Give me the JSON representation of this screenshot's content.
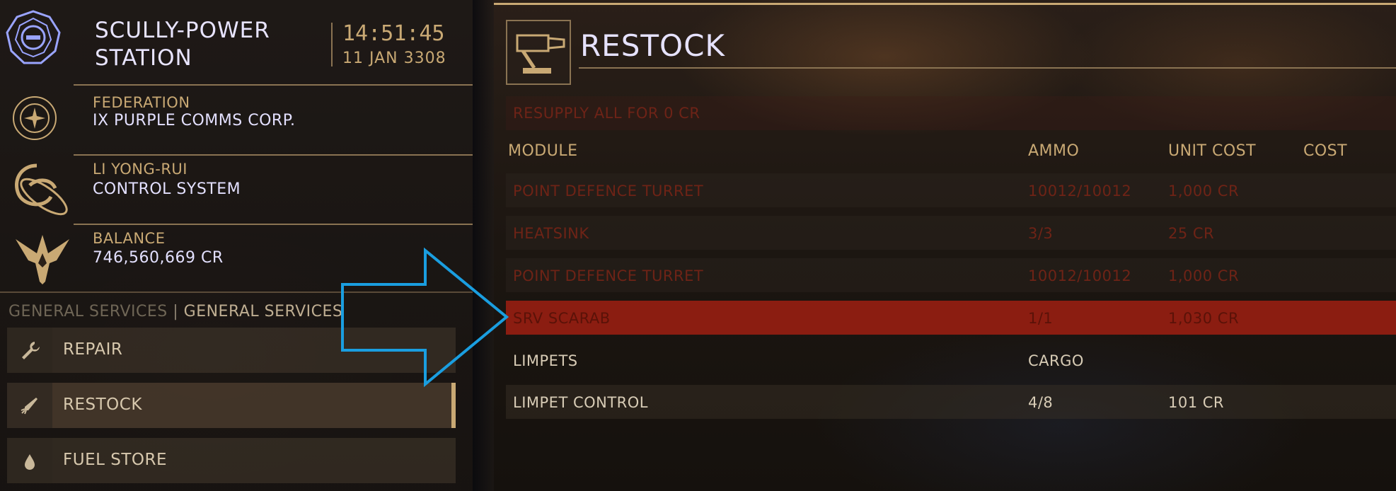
{
  "station": {
    "name_line1": "SCULLY-POWER",
    "name_line2": "STATION",
    "time": "14:51:45",
    "date": "11 JAN 3308"
  },
  "faction": {
    "allegiance": "FEDERATION",
    "name": "IX PURPLE COMMS CORP."
  },
  "system": {
    "owner": "LI YONG-RUI",
    "status": "CONTROL SYSTEM"
  },
  "balance": {
    "label": "BALANCE",
    "value": "746,560,669 CR"
  },
  "services": {
    "header_a": "GENERAL SERVICES",
    "sep": "|",
    "header_b": "GENERAL SERVICES"
  },
  "menu": [
    {
      "label": "REPAIR",
      "icon": "wrench-icon",
      "active": false
    },
    {
      "label": "RESTOCK",
      "icon": "missile-icon",
      "active": true
    },
    {
      "label": "FUEL STORE",
      "icon": "droplet-icon",
      "active": false
    }
  ],
  "panel": {
    "title": "RESTOCK",
    "resupply": "RESUPPLY ALL FOR 0 CR"
  },
  "table": {
    "columns": {
      "module": "MODULE",
      "ammo": "AMMO",
      "unit_cost": "UNIT COST",
      "cost": "COST"
    },
    "rows": [
      {
        "module": "POINT DEFENCE TURRET",
        "ammo": "10012/10012",
        "unit_cost": "1,000 CR",
        "state": "dim"
      },
      {
        "module": "HEATSINK",
        "ammo": "3/3",
        "unit_cost": "25 CR",
        "state": "dim"
      },
      {
        "module": "POINT DEFENCE TURRET",
        "ammo": "10012/10012",
        "unit_cost": "1,000 CR",
        "state": "dim"
      },
      {
        "module": "SRV SCARAB",
        "ammo": "1/1",
        "unit_cost": "1,030 CR",
        "state": "selected"
      }
    ],
    "section": {
      "label": "LIMPETS",
      "col": "CARGO"
    },
    "limpet_row": {
      "module": "LIMPET CONTROL",
      "ammo": "4/8",
      "unit_cost": "101 CR"
    }
  },
  "colors": {
    "accent": "#c9a974",
    "selection": "#a01e12",
    "annotation_arrow": "#1a9ee0"
  }
}
